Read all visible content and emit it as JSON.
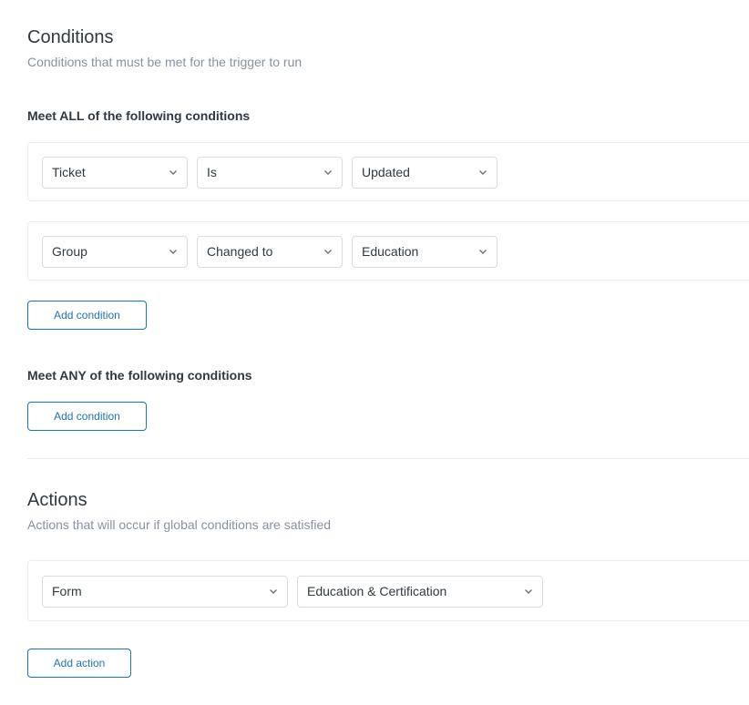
{
  "conditions": {
    "title": "Conditions",
    "subtitle": "Conditions that must be met for the trigger to run",
    "all": {
      "heading": "Meet ALL of the following conditions",
      "rows": [
        {
          "field": "Ticket",
          "operator": "Is",
          "value": "Updated"
        },
        {
          "field": "Group",
          "operator": "Changed to",
          "value": "Education"
        }
      ],
      "add_label": "Add condition"
    },
    "any": {
      "heading": "Meet ANY of the following conditions",
      "add_label": "Add condition"
    }
  },
  "actions": {
    "title": "Actions",
    "subtitle": "Actions that will occur if global conditions are satisfied",
    "rows": [
      {
        "field": "Form",
        "value": "Education & Certification"
      }
    ],
    "add_label": "Add action"
  },
  "icons": {
    "dropdown": "chevron-down-icon"
  },
  "colors": {
    "accent": "#1f73b7",
    "text": "#2f3941",
    "muted": "#87929d",
    "border": "#d8dcde"
  }
}
